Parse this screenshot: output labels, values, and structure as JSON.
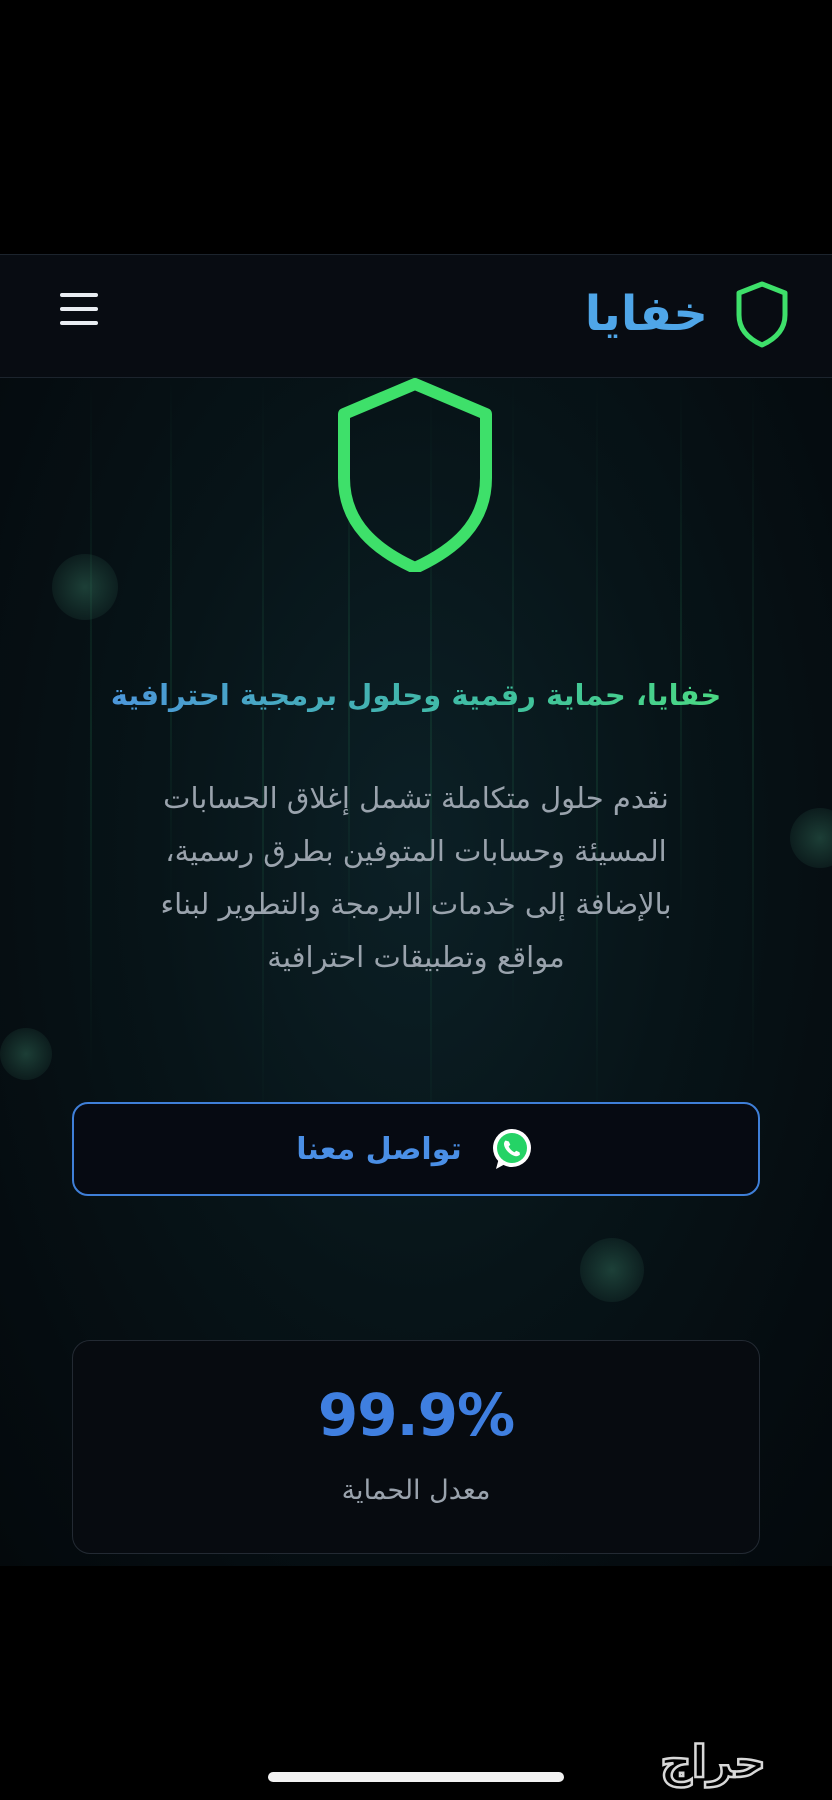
{
  "header": {
    "brand_name": "خفايا",
    "brand_icon": "shield-icon",
    "menu_icon": "hamburger-menu-icon"
  },
  "hero": {
    "icon": "shield-icon",
    "title": "خفايا، حماية رقمية وحلول برمجية احترافية",
    "description_lines": [
      "نقدم حلول متكاملة تشمل إغلاق الحسابات",
      "المسيئة وحسابات المتوفين بطرق رسمية،",
      "بالإضافة إلى خدمات البرمجة والتطوير لبناء",
      "مواقع وتطبيقات احترافية"
    ]
  },
  "contact_button": {
    "label": "تواصل معنا",
    "icon": "whatsapp-icon"
  },
  "stat": {
    "value": "99.9%",
    "label": "معدل الحماية"
  },
  "watermark": {
    "text": "حراج"
  },
  "colors": {
    "accent_green": "#3ee06a",
    "accent_blue": "#3f7fe0",
    "brand_blue": "#4fa6e8",
    "background": "#000000"
  }
}
